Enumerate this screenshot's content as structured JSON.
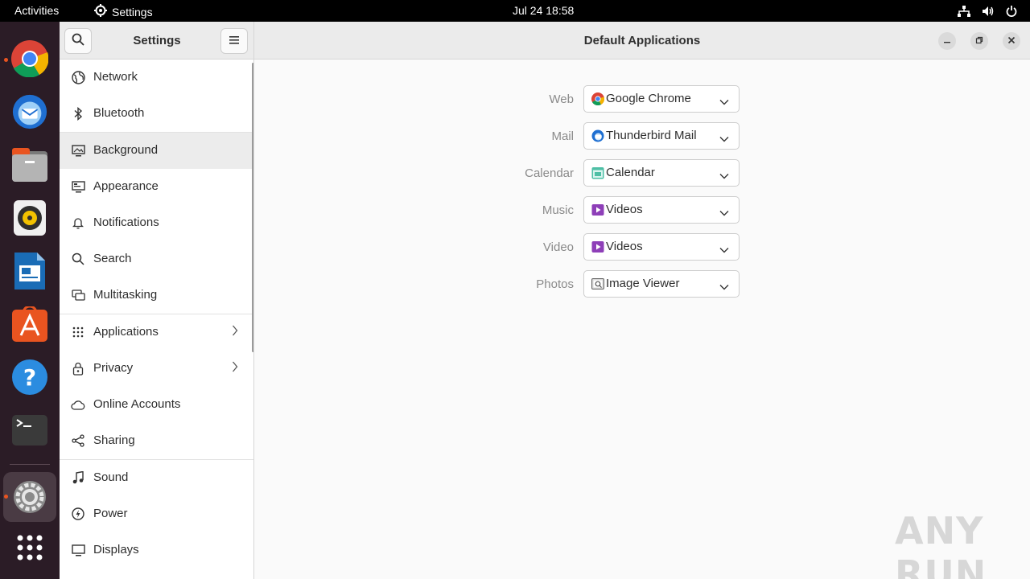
{
  "topbar": {
    "activities": "Activities",
    "app_name": "Settings",
    "clock": "Jul 24  18:58"
  },
  "dock": {
    "apps": [
      "chrome-icon",
      "thunderbird-icon",
      "files-icon",
      "rhythmbox-icon",
      "writer-icon",
      "app-center-icon",
      "help-icon",
      "terminal-icon",
      "settings-icon",
      "show-apps-icon"
    ]
  },
  "sidebar": {
    "title": "Settings",
    "items": [
      {
        "label": "Network"
      },
      {
        "label": "Bluetooth"
      },
      {
        "label": "Background"
      },
      {
        "label": "Appearance"
      },
      {
        "label": "Notifications"
      },
      {
        "label": "Search"
      },
      {
        "label": "Multitasking"
      },
      {
        "label": "Applications"
      },
      {
        "label": "Privacy"
      },
      {
        "label": "Online Accounts"
      },
      {
        "label": "Sharing"
      },
      {
        "label": "Sound"
      },
      {
        "label": "Power"
      },
      {
        "label": "Displays"
      }
    ]
  },
  "main": {
    "title": "Default Applications",
    "rows": [
      {
        "label": "Web",
        "value": "Google Chrome",
        "icon": "chrome-icon"
      },
      {
        "label": "Mail",
        "value": "Thunderbird Mail",
        "icon": "thunderbird-icon"
      },
      {
        "label": "Calendar",
        "value": "Calendar",
        "icon": "calendar-icon"
      },
      {
        "label": "Music",
        "value": "Videos",
        "icon": "videos-icon"
      },
      {
        "label": "Video",
        "value": "Videos",
        "icon": "videos-icon"
      },
      {
        "label": "Photos",
        "value": "Image Viewer",
        "icon": "image-viewer-icon"
      }
    ]
  },
  "watermark": "ANY RUN",
  "colors": {
    "accent": "#e95420",
    "dock_bg": "#2b1c26",
    "topbar_bg": "#000000"
  }
}
